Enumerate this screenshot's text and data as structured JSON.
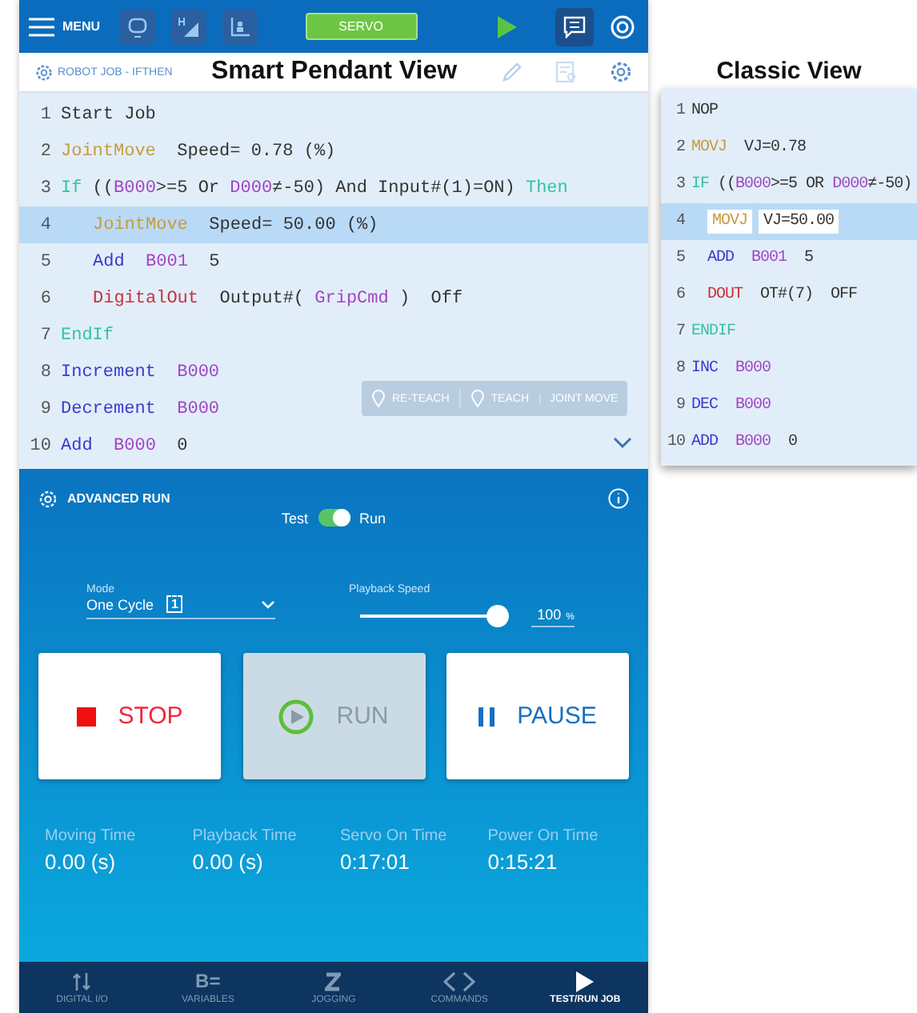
{
  "top_bar": {
    "menu_label": "MENU",
    "servo_label": "SERVO"
  },
  "header": {
    "job": "ROBOT JOB - IFTHEN",
    "title": "Smart Pendant View"
  },
  "smart_view": {
    "lines": [
      {
        "num": "1",
        "selected": false,
        "tokens": [
          {
            "text": "Start Job",
            "kind": "plain"
          }
        ]
      },
      {
        "num": "2",
        "selected": false,
        "tokens": [
          {
            "text": "JointMove",
            "kind": "move"
          },
          {
            "text": "  Speed= 0.78 (%)",
            "kind": "plain"
          }
        ]
      },
      {
        "num": "3",
        "selected": false,
        "tokens": [
          {
            "text": "If",
            "kind": "cond"
          },
          {
            "text": " ((",
            "kind": "plain"
          },
          {
            "text": "B000",
            "kind": "var"
          },
          {
            "text": ">=5 Or ",
            "kind": "plain"
          },
          {
            "text": "D000",
            "kind": "var"
          },
          {
            "text": "≠-50) And Input#(1)=ON) ",
            "kind": "plain"
          },
          {
            "text": "Then",
            "kind": "cond"
          }
        ],
        "children": [
          {
            "num": "4",
            "selected": true,
            "tokens": [
              {
                "text": "JointMove",
                "kind": "move"
              },
              {
                "text": "  Speed= 50.00 (%)",
                "kind": "plain"
              }
            ]
          },
          {
            "num": "5",
            "selected": false,
            "tokens": [
              {
                "text": "Add",
                "kind": "cmd"
              },
              {
                "text": "  B001",
                "kind": "var"
              },
              {
                "text": "  5",
                "kind": "plain"
              }
            ]
          },
          {
            "num": "6",
            "selected": false,
            "tokens": [
              {
                "text": "DigitalOut",
                "kind": "out"
              },
              {
                "text": "  Output#( ",
                "kind": "plain"
              },
              {
                "text": "GripCmd",
                "kind": "var"
              },
              {
                "text": " )  Off",
                "kind": "plain"
              }
            ]
          }
        ]
      },
      {
        "num": "7",
        "selected": false,
        "tokens": [
          {
            "text": "EndIf",
            "kind": "cond"
          }
        ]
      },
      {
        "num": "8",
        "selected": false,
        "tokens": [
          {
            "text": "Increment",
            "kind": "cmd"
          },
          {
            "text": "  B000",
            "kind": "var"
          }
        ]
      },
      {
        "num": "9",
        "selected": false,
        "tokens": [
          {
            "text": "Decrement",
            "kind": "cmd"
          },
          {
            "text": "  B000",
            "kind": "var"
          }
        ]
      },
      {
        "num": "10",
        "selected": false,
        "tokens": [
          {
            "text": "Add",
            "kind": "cmd"
          },
          {
            "text": "  B000",
            "kind": "var"
          },
          {
            "text": "  0",
            "kind": "plain"
          }
        ]
      }
    ],
    "toolbar": [
      "RE-TEACH",
      "TEACH",
      "JOINT MOVE"
    ]
  },
  "classic_view": {
    "title": "Classic View",
    "lines": [
      {
        "num": "1",
        "selected": false,
        "tokens": [
          {
            "text": "NOP",
            "kind": "plain"
          }
        ]
      },
      {
        "num": "2",
        "selected": false,
        "tokens": [
          {
            "text": "MOVJ",
            "kind": "move"
          },
          {
            "text": "  VJ=0.78",
            "kind": "plain"
          }
        ]
      },
      {
        "num": "3",
        "selected": false,
        "tokens": [
          {
            "text": "IF",
            "kind": "cond"
          },
          {
            "text": " ((",
            "kind": "plain"
          },
          {
            "text": "B000",
            "kind": "var"
          },
          {
            "text": ">=5 OR ",
            "kind": "plain"
          },
          {
            "text": "D000",
            "kind": "var"
          },
          {
            "text": "≠-50)",
            "kind": "plain"
          }
        ],
        "children": [
          {
            "num": "4",
            "selected": true,
            "tokens": [
              {
                "text": "MOVJ",
                "kind": "move",
                "boxed": true
              },
              {
                "text": "VJ=50.00",
                "kind": "plain",
                "boxed": true
              }
            ]
          },
          {
            "num": "5",
            "selected": false,
            "tokens": [
              {
                "text": "ADD",
                "kind": "cmd"
              },
              {
                "text": "  B001",
                "kind": "var"
              },
              {
                "text": "  5",
                "kind": "plain"
              }
            ]
          },
          {
            "num": "6",
            "selected": false,
            "tokens": [
              {
                "text": "DOUT",
                "kind": "out"
              },
              {
                "text": "  OT#(7)  OFF",
                "kind": "plain"
              }
            ]
          }
        ]
      },
      {
        "num": "7",
        "selected": false,
        "tokens": [
          {
            "text": "ENDIF",
            "kind": "cond"
          }
        ]
      },
      {
        "num": "8",
        "selected": false,
        "tokens": [
          {
            "text": "INC",
            "kind": "cmd"
          },
          {
            "text": "  B000",
            "kind": "var"
          }
        ]
      },
      {
        "num": "9",
        "selected": false,
        "tokens": [
          {
            "text": "DEC",
            "kind": "cmd"
          },
          {
            "text": "  B000",
            "kind": "var"
          }
        ]
      },
      {
        "num": "10",
        "selected": false,
        "tokens": [
          {
            "text": "ADD",
            "kind": "cmd"
          },
          {
            "text": "  B000",
            "kind": "var"
          },
          {
            "text": "  0",
            "kind": "plain"
          }
        ]
      }
    ]
  },
  "advanced_run": {
    "title": "ADVANCED RUN",
    "toggle": {
      "left": "Test",
      "right": "Run",
      "on": true
    },
    "mode": {
      "label": "Mode",
      "value": "One Cycle",
      "icon_text": "1"
    },
    "speed": {
      "label": "Playback Speed",
      "level": 1.0,
      "value": "100",
      "unit": "%"
    },
    "buttons": [
      {
        "label": "STOP",
        "kind": "stop",
        "disabled": false
      },
      {
        "label": "RUN",
        "kind": "run",
        "disabled": true
      },
      {
        "label": "PAUSE",
        "kind": "pause",
        "disabled": false
      }
    ],
    "stats": [
      {
        "label": "Moving Time",
        "value": "0.00 (s)"
      },
      {
        "label": "Playback Time",
        "value": "0.00 (s)"
      },
      {
        "label": "Servo On Time",
        "value": "0:17:01"
      },
      {
        "label": "Power On Time",
        "value": "0:15:21"
      }
    ]
  },
  "bottom_nav": [
    {
      "label": "DIGITAL I/O",
      "selected": false
    },
    {
      "label": "VARIABLES",
      "selected": false,
      "icon_text": "B="
    },
    {
      "label": "JOGGING",
      "selected": false
    },
    {
      "label": "COMMANDS",
      "selected": false
    },
    {
      "label": "TEST/RUN JOB",
      "selected": true
    }
  ]
}
